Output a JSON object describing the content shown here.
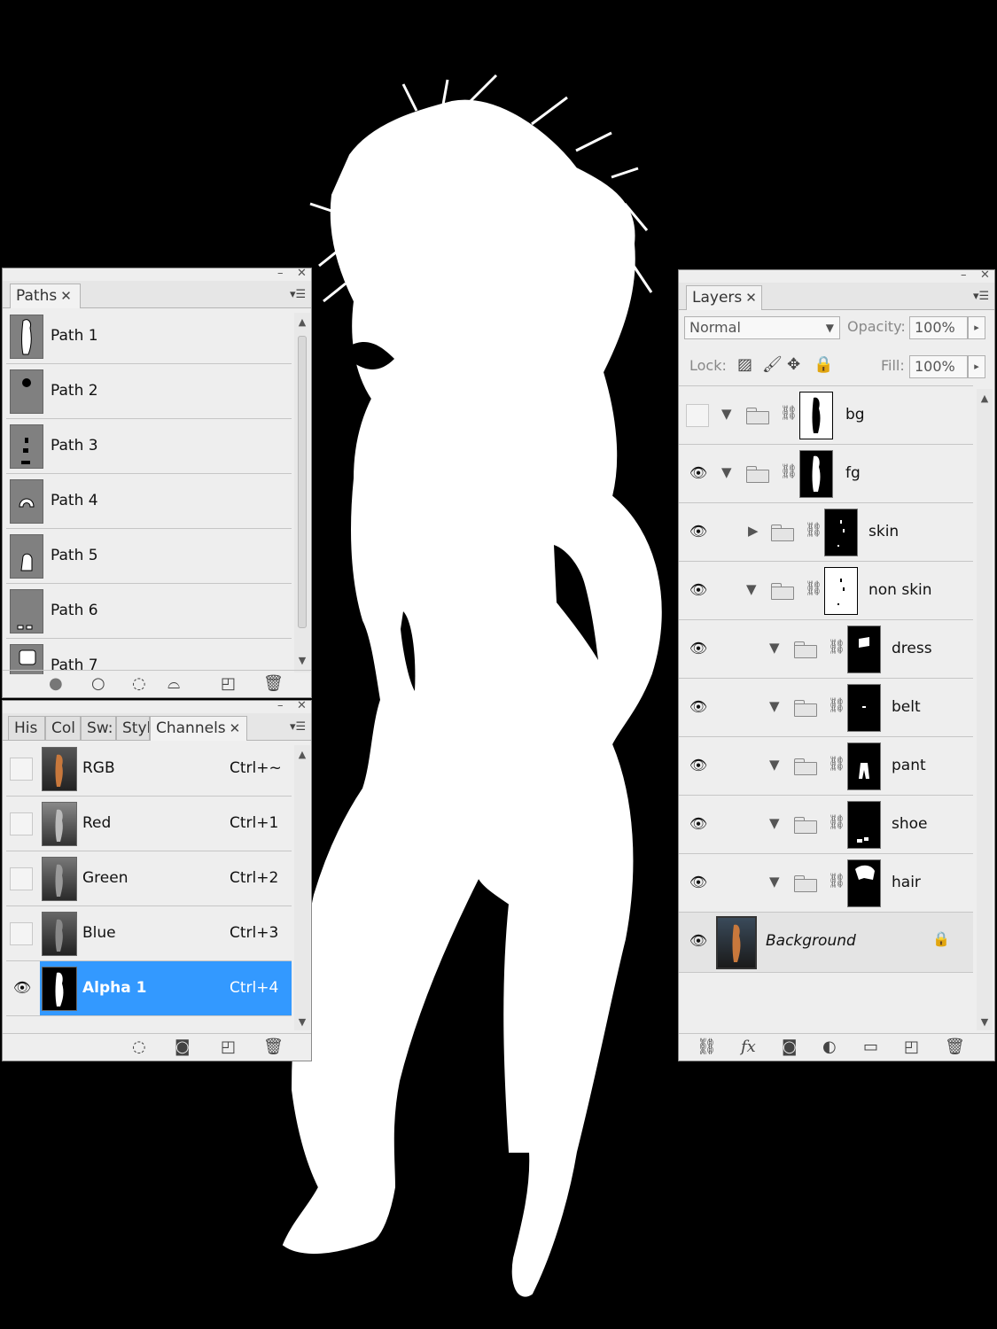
{
  "paths_panel": {
    "tab": "Paths",
    "items": [
      {
        "label": "Path 1"
      },
      {
        "label": "Path 2"
      },
      {
        "label": "Path 3"
      },
      {
        "label": "Path 4"
      },
      {
        "label": "Path 5"
      },
      {
        "label": "Path 6"
      },
      {
        "label": "Path 7"
      }
    ]
  },
  "channels_panel": {
    "tabs": [
      "His",
      "Col",
      "Sw:",
      "Styl",
      "Channels"
    ],
    "items": [
      {
        "label": "RGB",
        "shortcut": "Ctrl+~"
      },
      {
        "label": "Red",
        "shortcut": "Ctrl+1"
      },
      {
        "label": "Green",
        "shortcut": "Ctrl+2"
      },
      {
        "label": "Blue",
        "shortcut": "Ctrl+3"
      },
      {
        "label": "Alpha 1",
        "shortcut": "Ctrl+4"
      }
    ],
    "selected_color": "#3399ff"
  },
  "layers_panel": {
    "tab": "Layers",
    "blend_mode": "Normal",
    "opacity_label": "Opacity:",
    "opacity_value": "100%",
    "lock_label": "Lock:",
    "fill_label": "Fill:",
    "fill_value": "100%",
    "layers": [
      {
        "name": "bg"
      },
      {
        "name": "fg"
      },
      {
        "name": "skin"
      },
      {
        "name": "non skin"
      },
      {
        "name": "dress"
      },
      {
        "name": "belt"
      },
      {
        "name": "pant"
      },
      {
        "name": "shoe"
      },
      {
        "name": "hair"
      },
      {
        "name": "Background"
      }
    ]
  },
  "icons": {
    "close": "close-icon",
    "minimize": "minimize-icon",
    "panel_menu": "panel-menu-icon",
    "visibility": "eye-icon",
    "link": "chain-link-icon",
    "folder": "folder-icon",
    "lock": "padlock-icon"
  }
}
